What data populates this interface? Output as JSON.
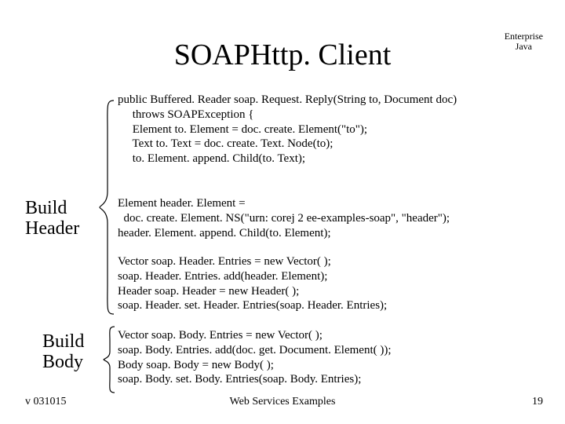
{
  "title": "SOAPHttp. Client",
  "corner": "Enterprise\nJava",
  "intro_code": "public Buffered. Reader soap. Request. Reply(String to, Document doc)\n     throws SOAPException {\n     Element to. Element = doc. create. Element(\"to\");\n     Text to. Text = doc. create. Text. Node(to);\n     to. Element. append. Child(to. Text);",
  "labels": {
    "header": "Build\nHeader",
    "body": "Build\nBody"
  },
  "header_block": "Element header. Element =\n  doc. create. Element. NS(\"urn: corej 2 ee-examples-soap\", \"header\");\nheader. Element. append. Child(to. Element);",
  "vector_header_block": "Vector soap. Header. Entries = new Vector( );\nsoap. Header. Entries. add(header. Element);\nHeader soap. Header = new Header( );\nsoap. Header. set. Header. Entries(soap. Header. Entries);",
  "body_block": "Vector soap. Body. Entries = new Vector( );\nsoap. Body. Entries. add(doc. get. Document. Element( ));\nBody soap. Body = new Body( );\nsoap. Body. set. Body. Entries(soap. Body. Entries);",
  "footer": {
    "left": "v 031015",
    "center": "Web Services Examples",
    "right": "19"
  }
}
